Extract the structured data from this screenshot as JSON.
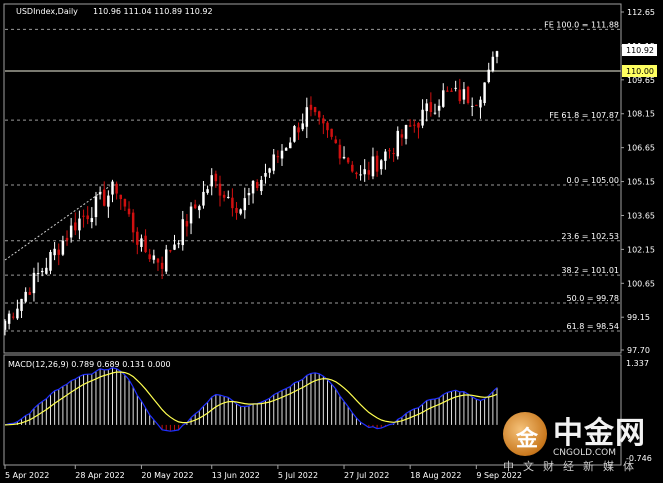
{
  "header": {
    "symbol": "USDIndex,Daily",
    "ohlc": "110.96 111.04 110.89 110.92"
  },
  "macd_label": "MACD(12,26,9) 0.789 0.689 0.131 0.000",
  "price_axis": {
    "ticks": [
      "112.65",
      "111.15",
      "109.65",
      "108.15",
      "106.65",
      "105.15",
      "103.65",
      "102.15",
      "100.65",
      "99.15",
      "97.70"
    ],
    "current": "110.92",
    "level": "110.00"
  },
  "macd_axis": {
    "top": "1.337",
    "bottom": "-0.746"
  },
  "date_axis": [
    "5 Apr 2022",
    "28 Apr 2022",
    "20 May 2022",
    "13 Jun 2022",
    "5 Jul 2022",
    "27 Jul 2022",
    "18 Aug 2022",
    "9 Sep 2022"
  ],
  "fib_levels": [
    {
      "label": "FE 100.0 = 111.88",
      "value": 111.88
    },
    {
      "label": "FE 61.8 = 107.87",
      "value": 107.87
    },
    {
      "label": "0.0 = 105.00",
      "value": 105.0
    },
    {
      "label": "23.6 = 102.53",
      "value": 102.53
    },
    {
      "label": "38.2 = 101.01",
      "value": 101.01
    },
    {
      "label": "50.0 = 99.78",
      "value": 99.78
    },
    {
      "label": "61.8 = 98.54",
      "value": 98.54
    }
  ],
  "watermark": {
    "name": "中金网",
    "domain": "CNGOLD.COM",
    "sub": "中文财经新媒体",
    "logo_char": "金"
  },
  "colors": {
    "bull": "#ffffff",
    "bear": "#d01010",
    "grid": "#9a9a9a",
    "macd_main": "#2030ff",
    "macd_signal": "#ffff50",
    "level": "#ffff60"
  },
  "chart_data": {
    "type": "candlestick",
    "symbol": "USDIndex",
    "timeframe": "Daily",
    "y_range": [
      97.7,
      112.65
    ],
    "horizontal_level": 110.0,
    "anchors": [
      {
        "date": "5 Apr 2022",
        "close": 99.0
      },
      {
        "date": "28 Apr 2022",
        "close": 103.3
      },
      {
        "date": "12 May 2022",
        "close": 104.9
      },
      {
        "date": "20 May 2022",
        "close": 102.2
      },
      {
        "date": "26 May 2022",
        "close": 101.6
      },
      {
        "date": "13 Jun 2022",
        "close": 105.2
      },
      {
        "date": "24 Jun 2022",
        "close": 104.0
      },
      {
        "date": "5 Jul 2022",
        "close": 106.3
      },
      {
        "date": "14 Jul 2022",
        "close": 108.2
      },
      {
        "date": "27 Jul 2022",
        "close": 106.4
      },
      {
        "date": "1 Aug 2022",
        "close": 105.3
      },
      {
        "date": "18 Aug 2022",
        "close": 107.5
      },
      {
        "date": "29 Aug 2022",
        "close": 109.0
      },
      {
        "date": "9 Sep 2022",
        "close": 108.9
      },
      {
        "date": "13 Sep 2022",
        "close": 109.8
      },
      {
        "date": "15 Sep 2022",
        "close": 110.92
      }
    ],
    "macd": {
      "params": "12,26,9",
      "main": 0.789,
      "signal": 0.689,
      "hist": 0.131,
      "range": [
        -0.746,
        1.337
      ]
    }
  }
}
